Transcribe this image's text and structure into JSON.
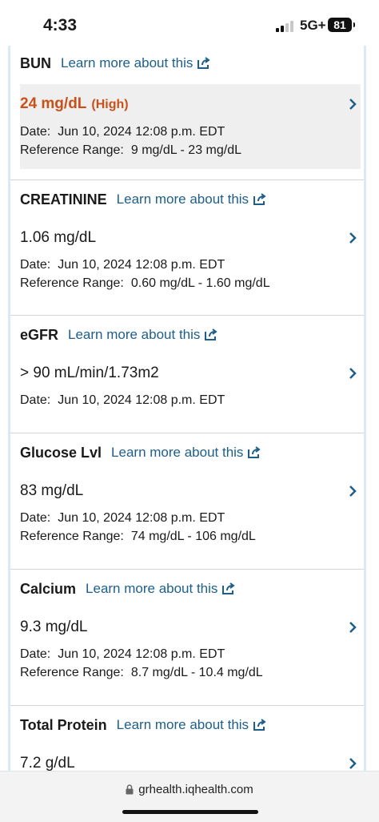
{
  "status_bar": {
    "time": "4:33",
    "network": "5G+",
    "battery": "81"
  },
  "learn_more_label": "Learn more about this",
  "results": [
    {
      "name": "BUN",
      "value": "24 mg/dL",
      "flag": "(High)",
      "date_label": "Date:",
      "date": "Jun 10, 2024 12:08 p.m. EDT",
      "range_label": "Reference Range:",
      "range": "9 mg/dL - 23 mg/dL"
    },
    {
      "name": "CREATININE",
      "value": "1.06 mg/dL",
      "date_label": "Date:",
      "date": "Jun 10, 2024 12:08 p.m. EDT",
      "range_label": "Reference Range:",
      "range": "0.60 mg/dL - 1.60 mg/dL"
    },
    {
      "name": "eGFR",
      "value": "> 90 mL/min/1.73m2",
      "date_label": "Date:",
      "date": "Jun 10, 2024 12:08 p.m. EDT"
    },
    {
      "name": "Glucose Lvl",
      "value": "83 mg/dL",
      "date_label": "Date:",
      "date": "Jun 10, 2024 12:08 p.m. EDT",
      "range_label": "Reference Range:",
      "range": "74 mg/dL - 106 mg/dL"
    },
    {
      "name": "Calcium",
      "value": "9.3 mg/dL",
      "date_label": "Date:",
      "date": "Jun 10, 2024 12:08 p.m. EDT",
      "range_label": "Reference Range:",
      "range": "8.7 mg/dL - 10.4 mg/dL"
    },
    {
      "name": "Total Protein",
      "value": "7.2 g/dL"
    }
  ],
  "browser": {
    "url": "grhealth.iqhealth.com"
  },
  "colors": {
    "link": "#1d5f8a",
    "abnormal": "#c8511b",
    "side_border": "#d6eaf8"
  }
}
